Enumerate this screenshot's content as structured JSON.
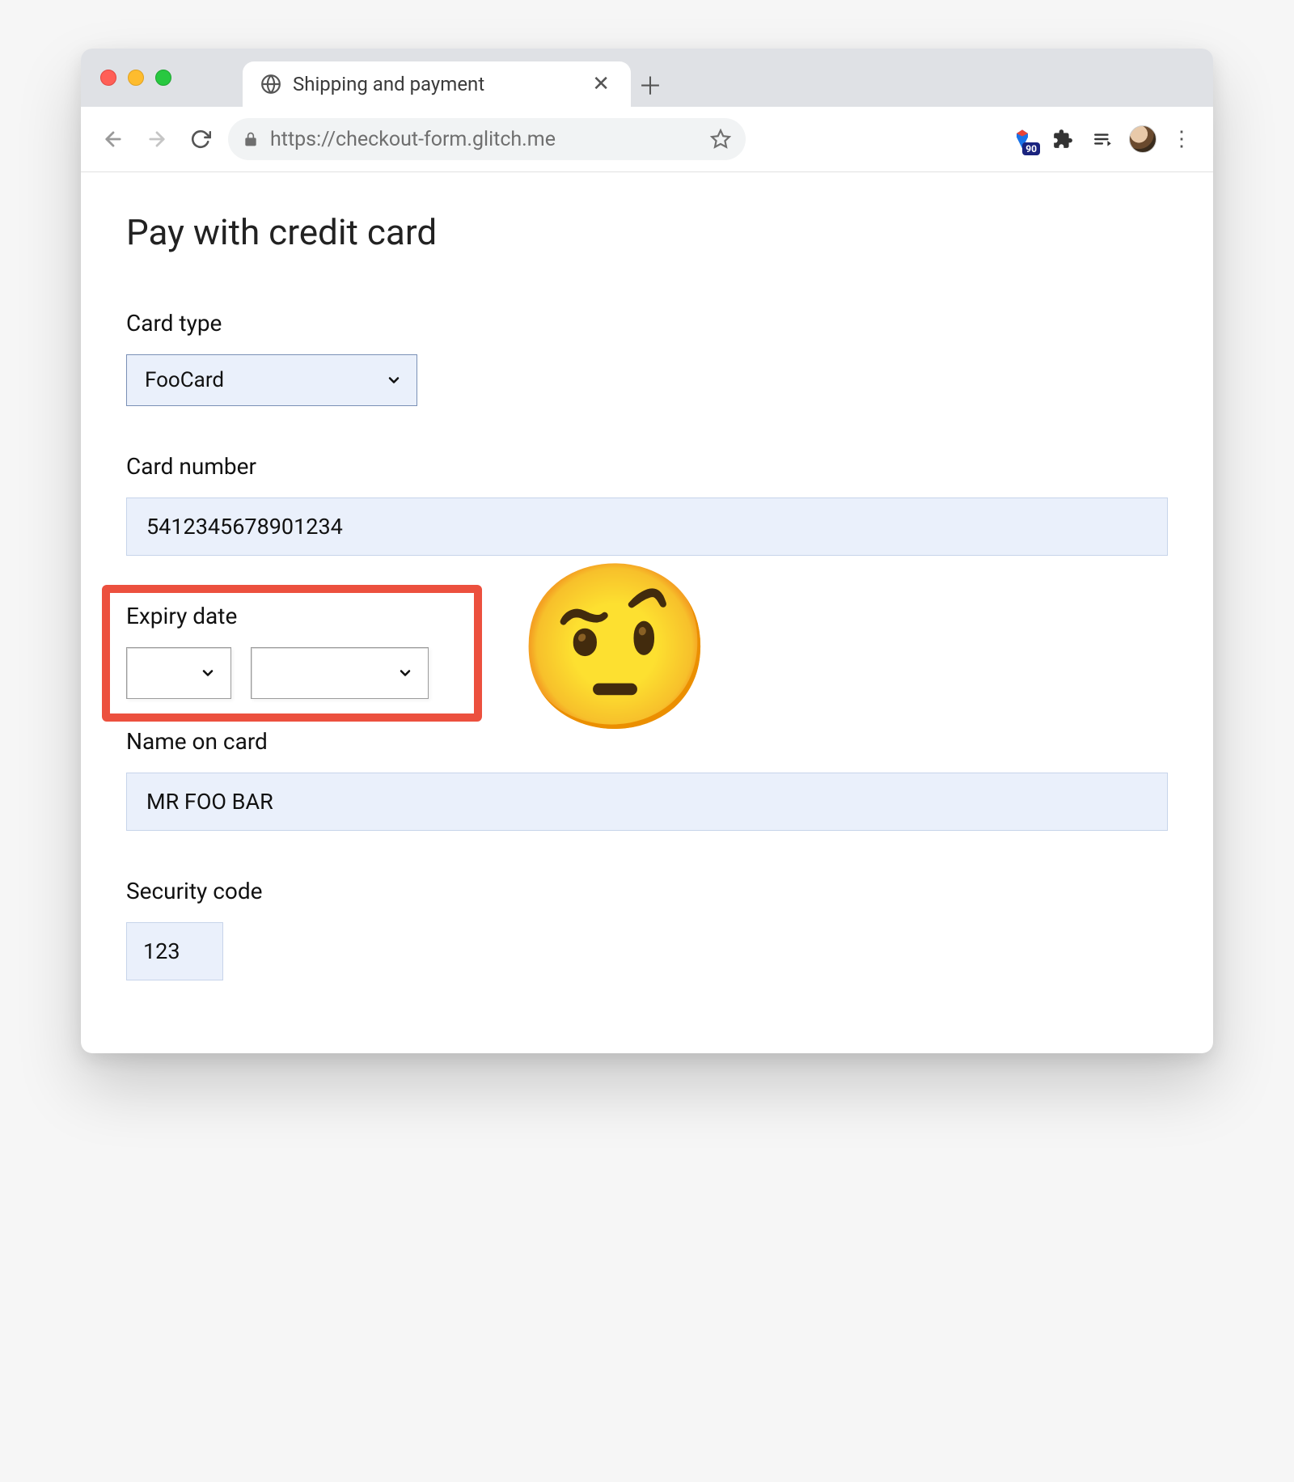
{
  "browser": {
    "tab_title": "Shipping and payment",
    "url_display": "https://checkout-form.glitch.me",
    "lighthouse_badge": "90"
  },
  "page": {
    "heading": "Pay with credit card",
    "card_type": {
      "label": "Card type",
      "selected": "FooCard"
    },
    "card_number": {
      "label": "Card number",
      "value": "5412345678901234"
    },
    "expiry": {
      "label": "Expiry date",
      "month_value": "",
      "year_value": ""
    },
    "name_on_card": {
      "label": "Name on card",
      "value": "MR FOO BAR"
    },
    "security_code": {
      "label": "Security code",
      "value": "123"
    }
  },
  "annotation": {
    "emoji": "🤨"
  }
}
